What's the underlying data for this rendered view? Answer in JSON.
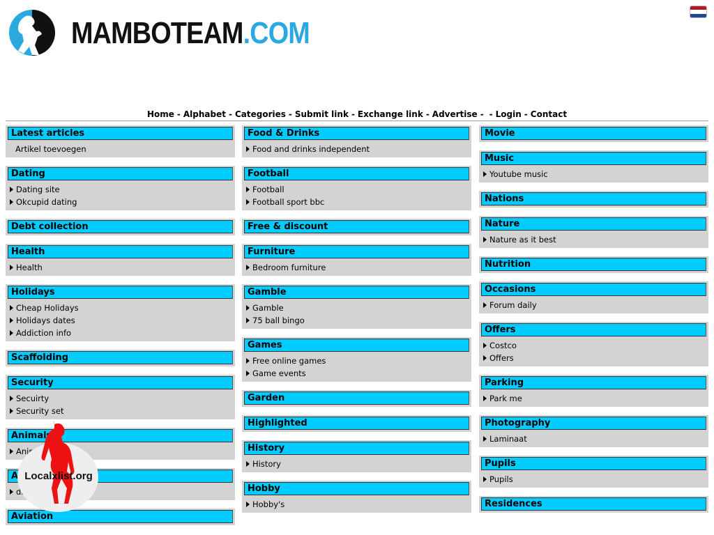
{
  "site": {
    "logo_brand": "MAMBOTEAM",
    "logo_tld": ".COM",
    "flag_colors": [
      "#ae1c28",
      "#ffffff",
      "#21468b"
    ],
    "flag_icon": "netherlands-flag-icon"
  },
  "nav": {
    "items": [
      "Home",
      "Alphabet",
      "Categories",
      "Submit link",
      "Exchange link",
      "Advertise",
      "",
      "Login",
      "Contact"
    ]
  },
  "colors": {
    "title_bar": "#00ccff",
    "box_bg": "#d3d3d3"
  },
  "columns": [
    [
      {
        "title": "Latest articles",
        "links": [
          "Artikel toevoegen"
        ],
        "no_arrow": true
      },
      {
        "title": "Dating",
        "links": [
          "Dating site",
          "Okcupid dating"
        ]
      },
      {
        "title": "Debt collection",
        "links": []
      },
      {
        "title": "Health",
        "links": [
          "Health"
        ]
      },
      {
        "title": "Holidays",
        "links": [
          "Cheap Holidays",
          "Holidays dates",
          "Addiction info"
        ]
      },
      {
        "title": "Scaffolding",
        "links": []
      },
      {
        "title": "Security",
        "links": [
          "Secuirty",
          "Security set"
        ]
      },
      {
        "title": "Animals",
        "links": [
          "Animals"
        ]
      },
      {
        "title": "Articles",
        "links": [
          "disposable email.nl"
        ]
      },
      {
        "title": "Aviation",
        "links": []
      }
    ],
    [
      {
        "title": "Food & Drinks",
        "links": [
          "Food and drinks independent"
        ]
      },
      {
        "title": "Football",
        "links": [
          "Football",
          "Football sport bbc"
        ]
      },
      {
        "title": "Free & discount",
        "links": []
      },
      {
        "title": "Furniture",
        "links": [
          "Bedroom furniture"
        ]
      },
      {
        "title": "Gamble",
        "links": [
          "Gamble",
          "75 ball bingo"
        ]
      },
      {
        "title": "Games",
        "links": [
          "Free online games",
          "Game events"
        ]
      },
      {
        "title": "Garden",
        "links": []
      },
      {
        "title": "Highlighted",
        "links": []
      },
      {
        "title": "History",
        "links": [
          "History"
        ]
      },
      {
        "title": "Hobby",
        "links": [
          "Hobby's"
        ]
      }
    ],
    [
      {
        "title": "Movie",
        "links": []
      },
      {
        "title": "Music",
        "links": [
          "Youtube music"
        ]
      },
      {
        "title": "Nations",
        "links": []
      },
      {
        "title": "Nature",
        "links": [
          "Nature as it best"
        ]
      },
      {
        "title": "Nutrition",
        "links": []
      },
      {
        "title": "Occasions",
        "links": [
          "Forum daily"
        ]
      },
      {
        "title": "Offers",
        "links": [
          "Costco",
          "Offers"
        ]
      },
      {
        "title": "Parking",
        "links": [
          "Park me"
        ]
      },
      {
        "title": "Photography",
        "links": [
          "Laminaat"
        ]
      },
      {
        "title": "Pupils",
        "links": [
          "Pupils"
        ]
      },
      {
        "title": "Residences",
        "links": []
      }
    ]
  ],
  "badge": {
    "text": "Localxlist.org",
    "icon": "localxlist-badge-icon"
  }
}
